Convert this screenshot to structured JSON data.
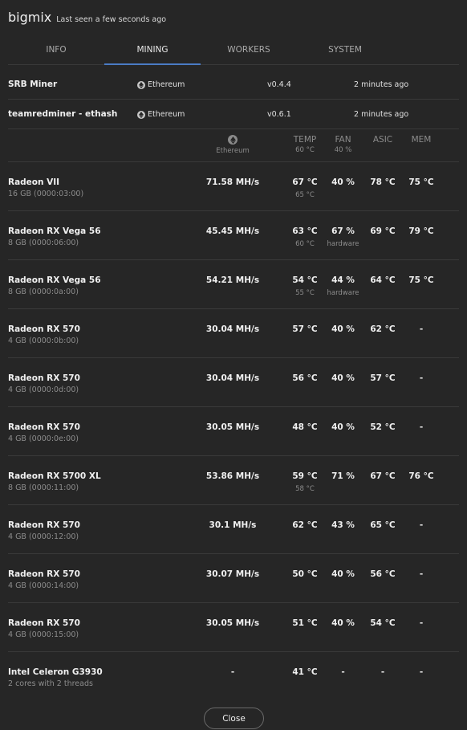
{
  "header": {
    "title": "bigmix",
    "subtitle": "Last seen a few seconds ago"
  },
  "tabs": [
    {
      "label": "INFO"
    },
    {
      "label": "MINING"
    },
    {
      "label": "WORKERS"
    },
    {
      "label": "SYSTEM"
    }
  ],
  "active_tab": "MINING",
  "miners": [
    {
      "name": "SRB Miner",
      "coin": "Ethereum",
      "version": "v0.4.4",
      "updated": "2 minutes ago"
    },
    {
      "name": "teamredminer - ethash",
      "coin": "Ethereum",
      "version": "v0.6.1",
      "updated": "2 minutes ago"
    }
  ],
  "columns": {
    "hash_coin": "Ethereum",
    "temp": "TEMP",
    "temp_sub": "60 °C",
    "fan": "FAN",
    "fan_sub": "40 %",
    "asic": "ASIC",
    "mem": "MEM"
  },
  "devices": [
    {
      "name": "Radeon VII",
      "sub": "16 GB (0000:03:00)",
      "hash": "71.58 MH/s",
      "temp": "67 °C",
      "temp2": "65 °C",
      "fan": "40 %",
      "fan2": "",
      "asic": "78 °C",
      "mem": "75 °C"
    },
    {
      "name": "Radeon RX Vega 56",
      "sub": "8 GB (0000:06:00)",
      "hash": "45.45 MH/s",
      "temp": "63 °C",
      "temp2": "60 °C",
      "fan": "67 %",
      "fan2": "hardware",
      "asic": "69 °C",
      "mem": "79 °C"
    },
    {
      "name": "Radeon RX Vega 56",
      "sub": "8 GB (0000:0a:00)",
      "hash": "54.21 MH/s",
      "temp": "54 °C",
      "temp2": "55 °C",
      "fan": "44 %",
      "fan2": "hardware",
      "asic": "64 °C",
      "mem": "75 °C"
    },
    {
      "name": "Radeon RX 570",
      "sub": "4 GB (0000:0b:00)",
      "hash": "30.04 MH/s",
      "temp": "57 °C",
      "temp2": "",
      "fan": "40 %",
      "fan2": "",
      "asic": "62 °C",
      "mem": "-"
    },
    {
      "name": "Radeon RX 570",
      "sub": "4 GB (0000:0d:00)",
      "hash": "30.04 MH/s",
      "temp": "56 °C",
      "temp2": "",
      "fan": "40 %",
      "fan2": "",
      "asic": "57 °C",
      "mem": "-"
    },
    {
      "name": "Radeon RX 570",
      "sub": "4 GB (0000:0e:00)",
      "hash": "30.05 MH/s",
      "temp": "48 °C",
      "temp2": "",
      "fan": "40 %",
      "fan2": "",
      "asic": "52 °C",
      "mem": "-"
    },
    {
      "name": "Radeon RX 5700 XL",
      "sub": "8 GB (0000:11:00)",
      "hash": "53.86 MH/s",
      "temp": "59 °C",
      "temp2": "58 °C",
      "fan": "71 %",
      "fan2": "",
      "asic": "67 °C",
      "mem": "76 °C"
    },
    {
      "name": "Radeon RX 570",
      "sub": "4 GB (0000:12:00)",
      "hash": "30.1 MH/s",
      "temp": "62 °C",
      "temp2": "",
      "fan": "43 %",
      "fan2": "",
      "asic": "65 °C",
      "mem": "-"
    },
    {
      "name": "Radeon RX 570",
      "sub": "4 GB (0000:14:00)",
      "hash": "30.07 MH/s",
      "temp": "50 °C",
      "temp2": "",
      "fan": "40 %",
      "fan2": "",
      "asic": "56 °C",
      "mem": "-"
    },
    {
      "name": "Radeon RX 570",
      "sub": "4 GB (0000:15:00)",
      "hash": "30.05 MH/s",
      "temp": "51 °C",
      "temp2": "",
      "fan": "40 %",
      "fan2": "",
      "asic": "54 °C",
      "mem": "-"
    },
    {
      "name": "Intel Celeron G3930",
      "sub": "2 cores with 2 threads",
      "hash": "-",
      "temp": "41 °C",
      "temp2": "",
      "fan": "-",
      "fan2": "",
      "asic": "-",
      "mem": "-"
    }
  ],
  "close_label": "Close"
}
